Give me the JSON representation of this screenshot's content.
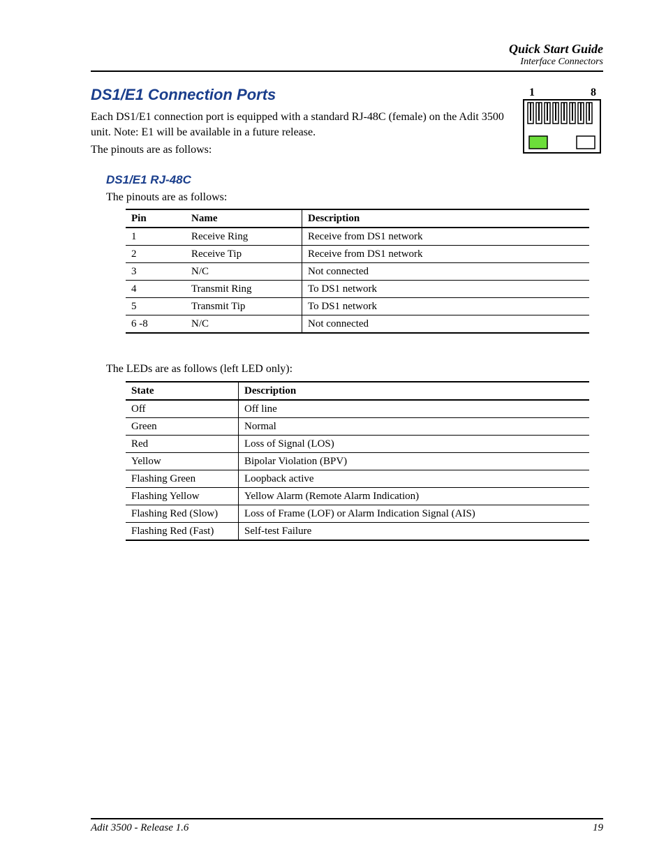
{
  "header": {
    "title": "Quick Start Guide",
    "subtitle": "Interface Connectors"
  },
  "section": {
    "heading": "DS1/E1 Connection Ports",
    "intro": "Each DS1/E1 connection port is equipped with a standard RJ-48C (female) on the Adit 3500 unit. Note: E1 will be available in a future release.",
    "pinouts_lead": "The pinouts are as follows:"
  },
  "connector": {
    "left_label": "1",
    "right_label": "8"
  },
  "subsection": {
    "heading": "DS1/E1 RJ-48C",
    "lead": "The pinouts are as follows:"
  },
  "pin_table": {
    "headers": {
      "pin": "Pin",
      "name": "Name",
      "description": "Description"
    },
    "rows": [
      {
        "pin": "1",
        "name": "Receive Ring",
        "description": "Receive from DS1 network"
      },
      {
        "pin": "2",
        "name": "Receive Tip",
        "description": "Receive from DS1 network"
      },
      {
        "pin": "3",
        "name": "N/C",
        "description": "Not connected"
      },
      {
        "pin": "4",
        "name": "Transmit Ring",
        "description": "To DS1 network"
      },
      {
        "pin": "5",
        "name": "Transmit Tip",
        "description": "To DS1 network"
      },
      {
        "pin": "6 -8",
        "name": "N/C",
        "description": "Not connected"
      }
    ]
  },
  "led_lead": "The LEDs are as follows (left LED only):",
  "led_table": {
    "headers": {
      "state": "State",
      "description": "Description"
    },
    "rows": [
      {
        "state": "Off",
        "description": "Off line"
      },
      {
        "state": "Green",
        "description": "Normal"
      },
      {
        "state": "Red",
        "description": "Loss of Signal (LOS)"
      },
      {
        "state": "Yellow",
        "description": "Bipolar Violation (BPV)"
      },
      {
        "state": "Flashing Green",
        "description": "Loopback active"
      },
      {
        "state": "Flashing Yellow",
        "description": "Yellow Alarm (Remote Alarm Indication)"
      },
      {
        "state": "Flashing Red (Slow)",
        "description": "Loss of Frame (LOF) or Alarm Indication Signal (AIS)"
      },
      {
        "state": "Flashing Red (Fast)",
        "description": "Self-test Failure"
      }
    ]
  },
  "footer": {
    "left": "Adit 3500  - Release 1.6",
    "right": "19"
  }
}
